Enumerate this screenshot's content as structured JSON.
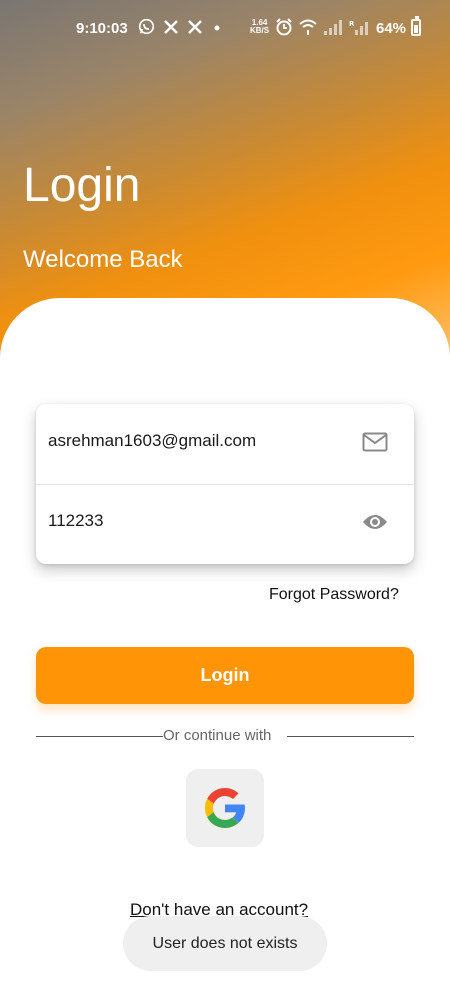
{
  "status_bar": {
    "time": "9:10:03",
    "net_speed_top": "1.64",
    "net_speed_unit": "KB/S",
    "battery": "64%",
    "left_icons": [
      "whatsapp-icon",
      "x-icon",
      "x-icon",
      "dot-icon"
    ],
    "right_icons": [
      "alarm-icon",
      "wifi-icon",
      "signal-icon",
      "roaming-signal-icon"
    ]
  },
  "header": {
    "title": "Login",
    "subtitle": "Welcome Back",
    "gradient_colors": [
      "#7a7672",
      "#f0900f",
      "#ffc06a"
    ]
  },
  "form": {
    "email_value": "asrehman1603@gmail.com",
    "password_value": "112233",
    "email_icon": "mail-icon",
    "password_icon": "eye-icon",
    "forgot_label": "Forgot Password?"
  },
  "actions": {
    "login_label": "Login",
    "accent": "#ff9407",
    "divider_text": "Or continue with",
    "google_icon": "google-icon",
    "signup_label": "Don't have an account?"
  },
  "toast": {
    "message": "User does not exists"
  }
}
